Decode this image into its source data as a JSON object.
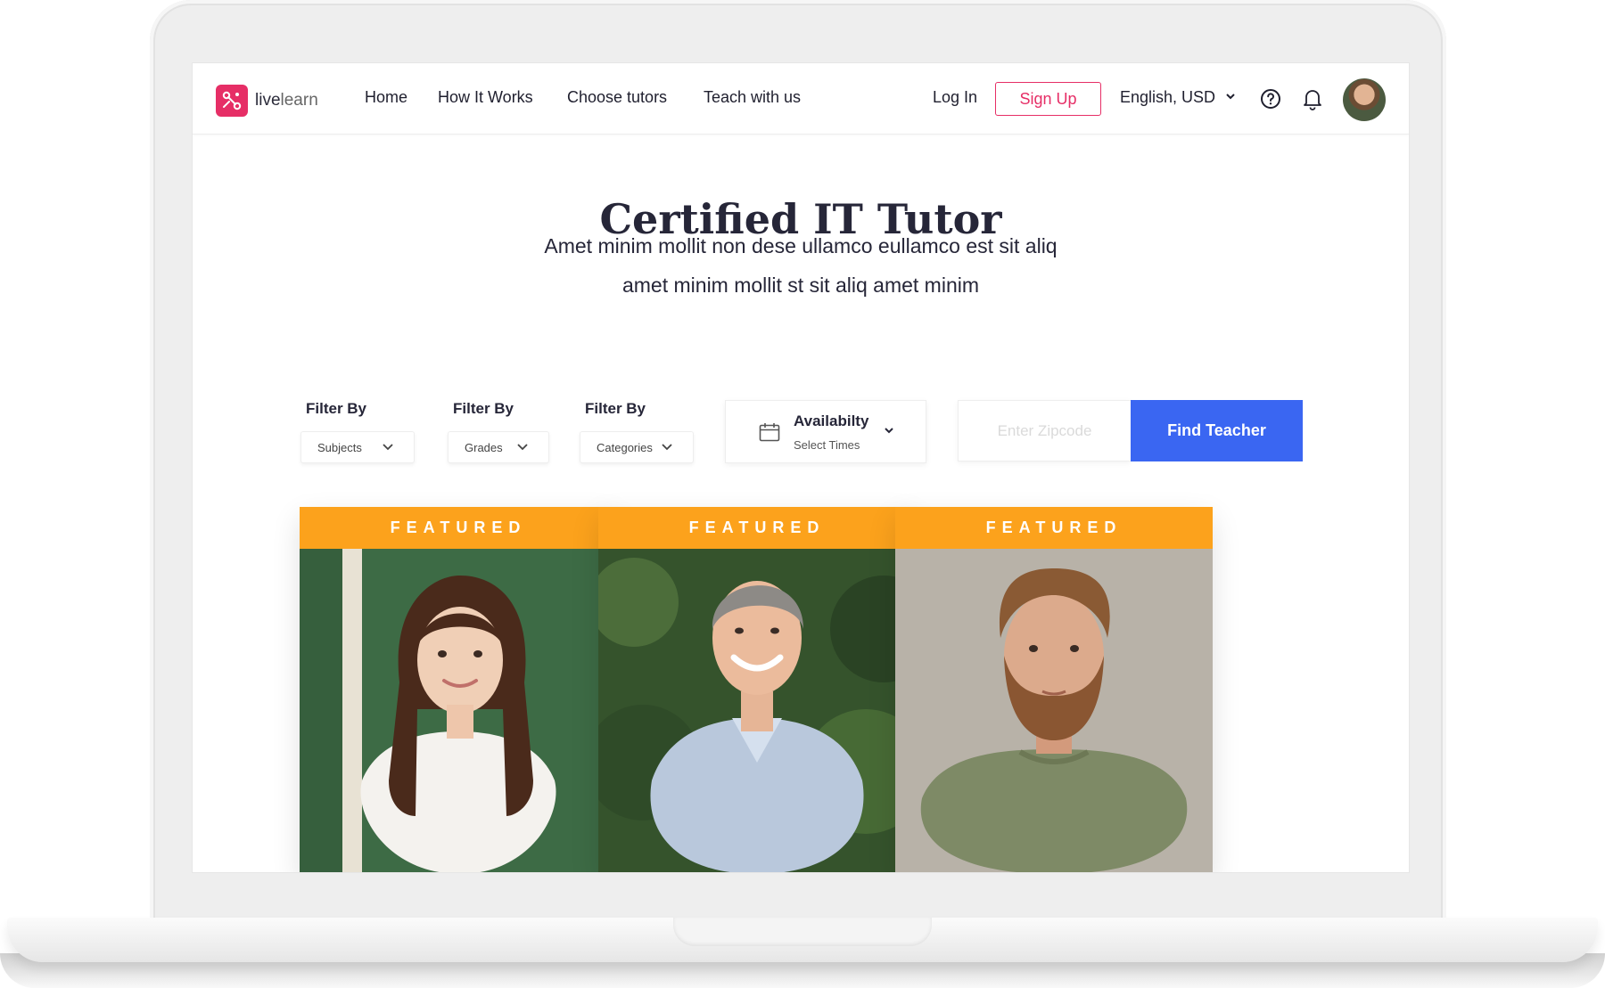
{
  "brand": {
    "name_part1": "live",
    "name_part2": "learn",
    "accent": "#e62e66"
  },
  "nav": {
    "links": [
      "Home",
      "How It Works",
      "Choose tutors",
      "Teach with us"
    ],
    "login": "Log In",
    "signup": "Sign Up",
    "language": "English, USD"
  },
  "hero": {
    "title": "Certified IT Tutor",
    "subtitle_line1": "Amet minim mollit non dese ullamco eullamco est sit aliq",
    "subtitle_line2": "amet minim mollit  st sit aliq amet minim"
  },
  "filters": [
    {
      "label": "Filter By",
      "value": "Subjects"
    },
    {
      "label": "Filter By",
      "value": "Grades"
    },
    {
      "label": "Filter By",
      "value": "Categories"
    }
  ],
  "availability": {
    "title": "Availabilty",
    "subtitle": "Select Times"
  },
  "search": {
    "placeholder": "Enter Zipcode",
    "button": "Find Teacher",
    "button_color": "#3a66f2"
  },
  "cards": [
    {
      "badge": "FEATURED"
    },
    {
      "badge": "FEATURED"
    },
    {
      "badge": "FEATURED"
    }
  ],
  "colors": {
    "featured": "#fca21c",
    "text": "#262638"
  },
  "icons": [
    "logo-icon",
    "chevron-down-icon",
    "help-icon",
    "bell-icon",
    "calendar-icon"
  ]
}
